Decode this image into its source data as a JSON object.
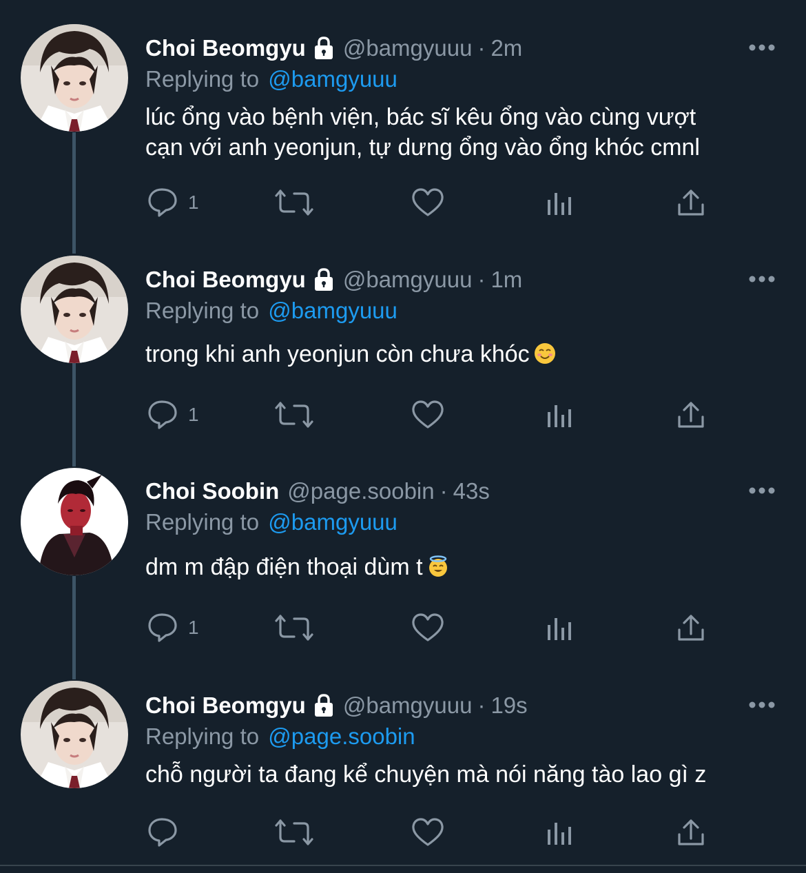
{
  "colors": {
    "background": "#15202b",
    "text_primary": "#ffffff",
    "text_secondary": "#8b98a5",
    "link": "#1d9bf0",
    "thread_line": "#3d5466"
  },
  "tweets": [
    {
      "name": "Choi Beomgyu",
      "locked": true,
      "handle": "@bamgyuuu",
      "dot": "·",
      "time": "2m",
      "replying_prefix": "Replying to",
      "replying_to": "@bamgyuuu",
      "text_lines": [
        "lúc ổng vào bệnh viện, bác sĩ kêu ổng vào cùng vượt",
        "cạn với anh yeonjun, tự dưng ổng vào ổng khóc cmnl"
      ],
      "emoji": "",
      "reply_count": "1",
      "avatar": "beomgyu"
    },
    {
      "name": "Choi Beomgyu",
      "locked": true,
      "handle": "@bamgyuuu",
      "dot": "·",
      "time": "1m",
      "replying_prefix": "Replying to",
      "replying_to": "@bamgyuuu",
      "text_lines": [
        "trong khi anh yeonjun còn chưa khóc"
      ],
      "emoji": "smiling-face-icon",
      "reply_count": "1",
      "avatar": "beomgyu"
    },
    {
      "name": "Choi Soobin",
      "locked": false,
      "handle": "@page.soobin",
      "dot": "·",
      "time": "43s",
      "replying_prefix": "Replying to",
      "replying_to": "@bamgyuuu",
      "text_lines": [
        "dm m đập điện thoại dùm t"
      ],
      "emoji": "halo-face-icon",
      "reply_count": "1",
      "avatar": "soobin"
    },
    {
      "name": "Choi Beomgyu",
      "locked": true,
      "handle": "@bamgyuuu",
      "dot": "·",
      "time": "19s",
      "replying_prefix": "Replying to",
      "replying_to": "@page.soobin",
      "text_lines": [
        "chỗ người ta đang kể chuyện mà nói năng tào lao gì z"
      ],
      "emoji": "",
      "reply_count": "",
      "avatar": "beomgyu"
    }
  ]
}
